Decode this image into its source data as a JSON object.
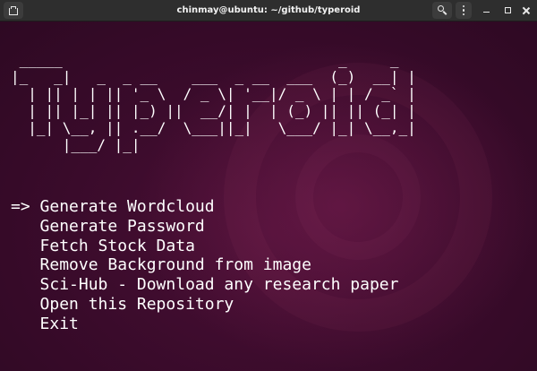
{
  "window": {
    "title": "chinmay@ubuntu: ~/github/typeroid"
  },
  "titlebar": {
    "icons": [
      "new-tab-icon",
      "search-icon",
      "hamburger-menu-icon",
      "minimize-icon",
      "maximize-icon",
      "close-icon"
    ]
  },
  "terminal": {
    "banner_lines": [
      " _____                                _     _ ",
      "|_   _|   _  _ __    ___  _ __  ___  (_)  __| |",
      "  | || | | || '_ \\  / _ \\| '__|/ _ \\ | | / _` |",
      "  | || |_| || |_) ||  __/| |  | (_) || || (_| |",
      "  |_| \\__, || .__/  \\___||_|   \\___/ |_| \\__,_|",
      "      |___/ |_|                                 "
    ],
    "selector": "=>",
    "menu_items": [
      {
        "label": "Generate Wordcloud",
        "selected": true
      },
      {
        "label": "Generate Password",
        "selected": false
      },
      {
        "label": "Fetch Stock Data",
        "selected": false
      },
      {
        "label": "Remove Background from image",
        "selected": false
      },
      {
        "label": "Sci-Hub - Download any research paper",
        "selected": false
      },
      {
        "label": "Open this Repository",
        "selected": false
      },
      {
        "label": "Exit",
        "selected": false
      }
    ]
  },
  "colors": {
    "titlebar_bg": "#2e2e2e",
    "terminal_bg": "#3a0b2b",
    "text": "#ffffff"
  }
}
